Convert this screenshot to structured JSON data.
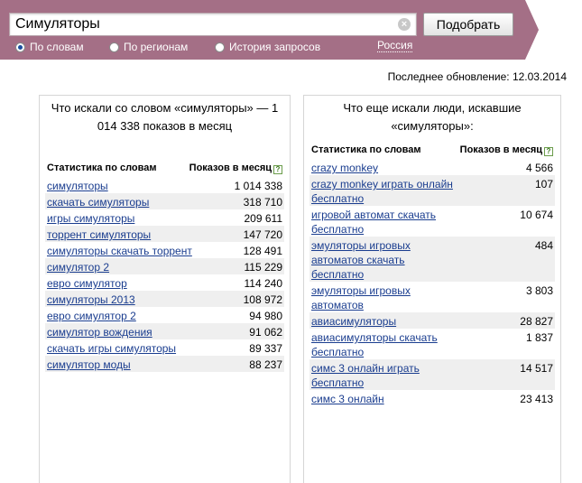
{
  "search": {
    "query": "Симуляторы",
    "submit_label": "Подобрать",
    "clear_icon": "close-circle-icon"
  },
  "modes": [
    {
      "label": "По словам",
      "checked": true
    },
    {
      "label": "По регионам",
      "checked": false
    },
    {
      "label": "История запросов",
      "checked": false
    }
  ],
  "region": "Россия",
  "last_update": "Последнее обновление: 12.03.2014",
  "colors": {
    "header": "#a46f86",
    "link": "#1a3d8f",
    "row_alt": "#efefef"
  },
  "left_panel": {
    "title": "Что искали со словом «симуляторы» — 1 014 338 показов в месяц",
    "col_words": "Статистика по словам",
    "col_count": "Показов в месяц",
    "rows": [
      {
        "phrase": "симуляторы",
        "count": "1 014 338"
      },
      {
        "phrase": "скачать симуляторы",
        "count": "318 710"
      },
      {
        "phrase": "игры симуляторы",
        "count": "209 611"
      },
      {
        "phrase": "торрент симуляторы",
        "count": "147 720"
      },
      {
        "phrase": "симуляторы скачать торрент",
        "count": "128 491"
      },
      {
        "phrase": "симулятор 2",
        "count": "115 229"
      },
      {
        "phrase": "евро симулятор",
        "count": "114 240"
      },
      {
        "phrase": "симуляторы 2013",
        "count": "108 972"
      },
      {
        "phrase": "евро симулятор 2",
        "count": "94 980"
      },
      {
        "phrase": "симулятор вождения",
        "count": "91 062"
      },
      {
        "phrase": "скачать игры симуляторы",
        "count": "89 337"
      },
      {
        "phrase": "симулятор моды",
        "count": "88 237"
      }
    ]
  },
  "right_panel": {
    "title": "Что еще искали люди, искавшие «симуляторы»:",
    "col_words": "Статистика по словам",
    "col_count": "Показов в месяц",
    "rows": [
      {
        "phrase": "crazy monkey",
        "count": "4 566"
      },
      {
        "phrase": "crazy monkey играть онлайн бесплатно",
        "count": "107"
      },
      {
        "phrase": "игровой автомат скачать бесплатно",
        "count": "10 674"
      },
      {
        "phrase": "эмуляторы игровых автоматов скачать бесплатно",
        "count": "484"
      },
      {
        "phrase": "эмуляторы игровых автоматов",
        "count": "3 803"
      },
      {
        "phrase": "авиасимуляторы",
        "count": "28 827"
      },
      {
        "phrase": "авиасимуляторы скачать бесплатно",
        "count": "1 837"
      },
      {
        "phrase": "симс 3 онлайн играть бесплатно",
        "count": "14 517"
      },
      {
        "phrase": "симс 3 онлайн",
        "count": "23 413"
      }
    ]
  }
}
